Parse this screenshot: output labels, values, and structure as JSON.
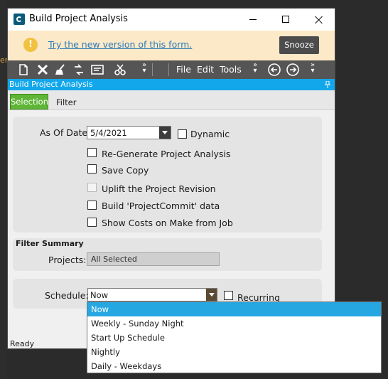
{
  "window": {
    "title": "Build Project Analysis"
  },
  "background": {
    "ghost_text": "er"
  },
  "banner": {
    "link_text": "Try the new version of this form.",
    "snooze_label": "Snooze",
    "warn_glyph": "!"
  },
  "toolbar": {
    "icons": [
      "new-icon",
      "delete-icon",
      "clear-icon",
      "refresh-icon",
      "print-preview-icon",
      "cut-icon",
      "back-icon",
      "forward-icon"
    ],
    "menus": {
      "file": "File",
      "edit": "Edit",
      "tools": "Tools"
    },
    "more_glyph": "»"
  },
  "panel": {
    "title": "Build Project Analysis"
  },
  "tabs": {
    "selection": "Selection",
    "filter": "Filter"
  },
  "form": {
    "as_of_date_label": "As Of Date:",
    "as_of_date_value": "5/4/2021",
    "dynamic_label": "Dynamic",
    "regenerate_label": "Re-Generate Project Analysis",
    "save_copy_label": "Save Copy",
    "uplift_label": "Uplift the Project Revision",
    "project_commit_label": "Build 'ProjectCommit' data",
    "show_costs_label": "Show Costs on Make from Job"
  },
  "filter_summary": {
    "title": "Filter Summary",
    "projects_label": "Projects:",
    "projects_value": "All Selected"
  },
  "schedule": {
    "label": "Schedule:",
    "value": "Now",
    "recurring_label": "Recurring",
    "options": [
      "Now",
      "Weekly - Sunday Night",
      "Start Up Schedule",
      "Nightly",
      "Daily - Weekdays"
    ],
    "selected_option": "Now"
  },
  "status": {
    "text": "Ready"
  },
  "colors": {
    "accent": "#12a7ea",
    "tab_active": "#5fb536",
    "banner_bg": "#fbe9c8",
    "toolbar_bg": "#555555"
  }
}
